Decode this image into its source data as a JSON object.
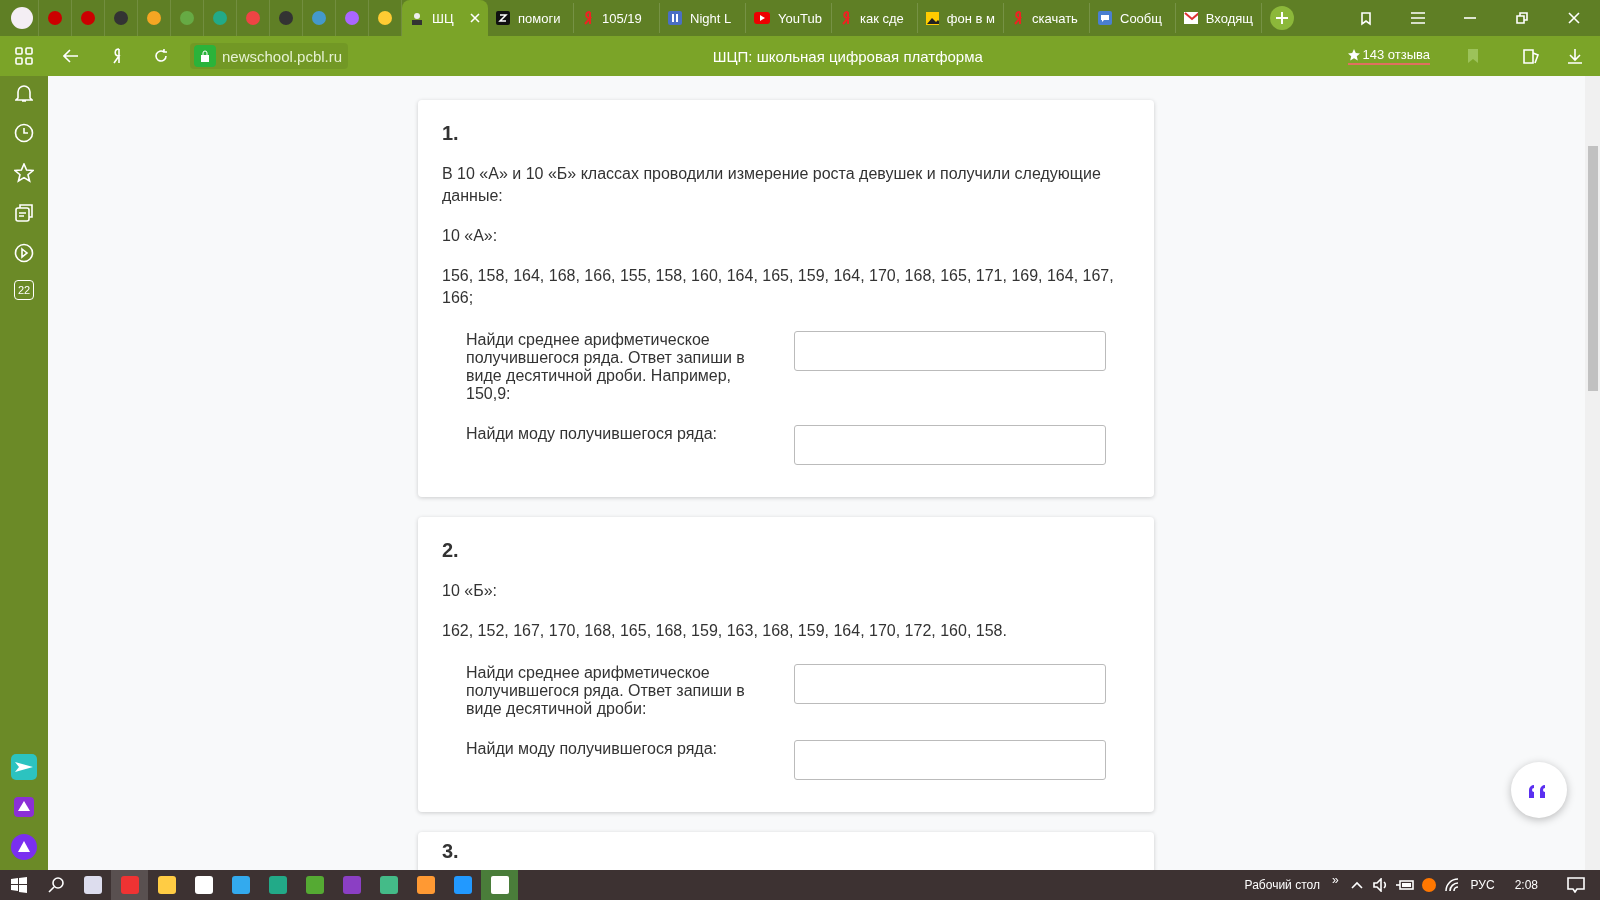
{
  "browser": {
    "tabs": [
      {
        "label": "ШЦ",
        "selected": true,
        "kind": "school"
      },
      {
        "label": "помоги",
        "selected": false,
        "kind": "z"
      },
      {
        "label": "105/19",
        "selected": false,
        "kind": "ya"
      },
      {
        "label": "Night L",
        "selected": false,
        "kind": "pause"
      },
      {
        "label": "YouTub",
        "selected": false,
        "kind": "yt"
      },
      {
        "label": "как сде",
        "selected": false,
        "kind": "ya"
      },
      {
        "label": "фон в м",
        "selected": false,
        "kind": "image"
      },
      {
        "label": "скачать",
        "selected": false,
        "kind": "ya"
      },
      {
        "label": "Сообщ",
        "selected": false,
        "kind": "chat"
      },
      {
        "label": "Входящ",
        "selected": false,
        "kind": "mail"
      }
    ],
    "url": "newschool.pcbl.ru",
    "page_title": "ШЦП: школьная цифровая платформа",
    "reviews": "143 отзыва",
    "sidebar_badge": "22"
  },
  "tasks": [
    {
      "number": "1.",
      "paragraphs": [
        "В 10 «А» и 10 «Б» классах проводили измерение роста девушек и получили следующие данные:",
        "10 «А»:",
        "156, 158, 164, 168, 166, 155, 158, 160, 164, 165, 159, 164, 170, 168, 165, 171, 169, 164, 167, 166;"
      ],
      "questions": [
        {
          "prompt": "Найди среднее арифметическое получившегося ряда. Ответ запиши в виде десятичной дроби. Например, 150,9:"
        },
        {
          "prompt": "Найди моду получившегося ряда:"
        }
      ]
    },
    {
      "number": "2.",
      "paragraphs": [
        "10 «Б»:",
        "162, 152, 167, 170, 168, 165, 168, 159, 163, 168, 159, 164, 170, 172, 160, 158."
      ],
      "questions": [
        {
          "prompt": "Найди среднее арифметическое получившегося ряда. Ответ запиши в виде десятичной дроби:"
        },
        {
          "prompt": "Найди моду получившегося ряда:"
        }
      ]
    },
    {
      "number": "3."
    }
  ],
  "taskbar": {
    "desktop_label": "Рабочий стол",
    "expand": "»",
    "language": "РУС",
    "time": "2:08"
  }
}
